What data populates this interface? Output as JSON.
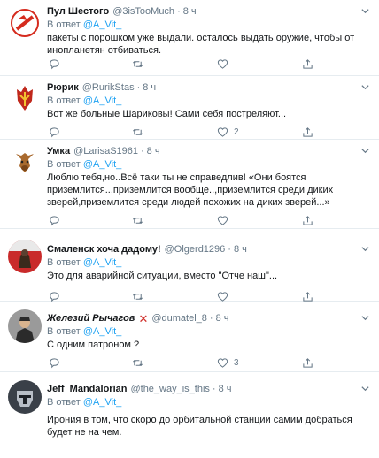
{
  "colors": {
    "accent": "#1da1f2",
    "muted": "#657786",
    "text": "#14171a",
    "divider": "#e6ecf0",
    "danger": "#d0312d"
  },
  "tweets": [
    {
      "name": "Пул Шестого",
      "handle": "@3isTooMuch",
      "time": "8 ч",
      "reply_prefix": "В ответ",
      "reply_to": "@A_Vit_",
      "text": "пакеты с порошком уже выдали. осталось выдать оружие, чтобы от инопланетян отбиваться.",
      "replies": "",
      "retweets": "",
      "likes": ""
    },
    {
      "name": "Рюрик",
      "handle": "@RurikStas",
      "time": "8 ч",
      "reply_prefix": "В ответ",
      "reply_to": "@A_Vit_",
      "text": "Вот же больные Шариковы! Сами себя постреляют...",
      "replies": "",
      "retweets": "",
      "likes": "2"
    },
    {
      "name": "Умка",
      "handle": "@LarisaS1961",
      "time": "8 ч",
      "reply_prefix": "В ответ",
      "reply_to": "@A_Vit_",
      "text": "Люблю тебя,но..Всё таки ты не справедлив! «Они боятся приземлится..,приземлится вообще..,приземлится среди диких зверей,приземлится среди людей похожих на диких зверей...»",
      "replies": "",
      "retweets": "",
      "likes": ""
    },
    {
      "name": "Смаленск хоча дадому!",
      "handle": "@Olgerd1296",
      "time": "8 ч",
      "reply_prefix": "В ответ",
      "reply_to": "@A_Vit_",
      "text": "Это для аварийной ситуации, вместо \"Отче наш\"...",
      "replies": "",
      "retweets": "",
      "likes": ""
    },
    {
      "name": "Железий Рычагов",
      "handle": "@dumatel_8",
      "time": "8 ч",
      "reply_prefix": "В ответ",
      "reply_to": "@A_Vit_",
      "text": "С одним патроном ?",
      "replies": "",
      "retweets": "",
      "likes": "3"
    },
    {
      "name": "Jeff_Mandalorian",
      "handle": "@the_way_is_this",
      "time": "8 ч",
      "reply_prefix": "В ответ",
      "reply_to": "@A_Vit_",
      "text": "Ирония в том, что скоро до орбитальной станции самим добраться будет не на чем.",
      "replies": "",
      "retweets": "",
      "likes": ""
    }
  ],
  "separator_dot": "·",
  "icons": [
    "reply-icon",
    "retweet-icon",
    "like-icon",
    "share-icon",
    "chevron-down-icon",
    "red-cross-icon"
  ]
}
